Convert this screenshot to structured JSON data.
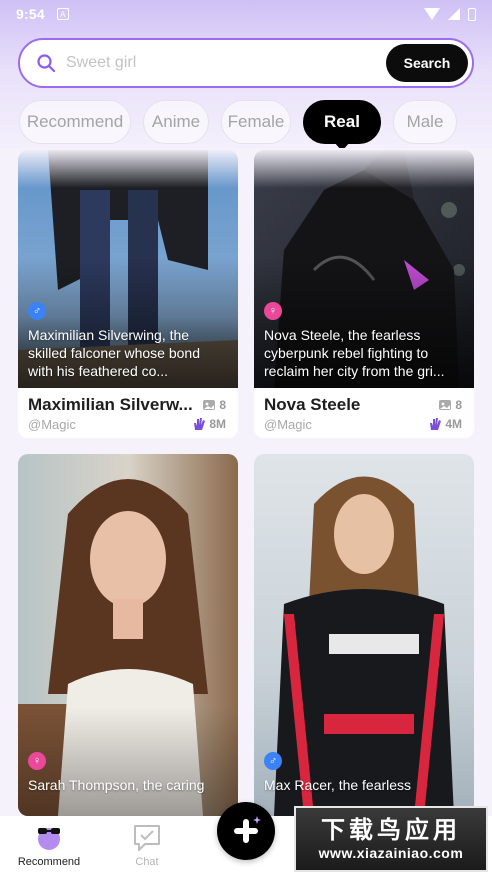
{
  "status_bar": {
    "time": "9:54",
    "notification_glyph": "A"
  },
  "search": {
    "placeholder": "Sweet girl",
    "button_label": "Search"
  },
  "tabs": [
    {
      "label": "Recommend",
      "active": false
    },
    {
      "label": "Anime",
      "active": false
    },
    {
      "label": "Female",
      "active": false
    },
    {
      "label": "Real",
      "active": true
    },
    {
      "label": "Male",
      "active": false
    }
  ],
  "cards": [
    {
      "gender": "male",
      "gender_glyph": "♂",
      "description": "Maximilian Silverwing, the skilled falconer whose bond with his feathered co...",
      "title": "Maximilian Silverw...",
      "author": "@Magic",
      "images_count": "8",
      "likes": "8M"
    },
    {
      "gender": "female",
      "gender_glyph": "♀",
      "description": "Nova Steele, the fearless cyberpunk rebel fighting to reclaim her city from the gri...",
      "title": "Nova Steele",
      "author": "@Magic",
      "images_count": "8",
      "likes": "4M"
    },
    {
      "gender": "female",
      "gender_glyph": "♀",
      "description": "Sarah Thompson, the caring"
    },
    {
      "gender": "male",
      "gender_glyph": "♂",
      "description": "Max Racer, the fearless"
    }
  ],
  "bottom_nav": {
    "items": [
      {
        "label": "Recommend",
        "icon": "recommend-avatar-icon",
        "active": true
      },
      {
        "label": "Chat",
        "icon": "chat-icon",
        "active": false
      }
    ],
    "fab_icon": "plus-icon"
  },
  "watermark": {
    "title": "下载鸟应用",
    "url": "www.xiazainiao.com"
  },
  "colors": {
    "accent": "#9b6bf0",
    "male": "#3b82f6",
    "female": "#ec4899",
    "dark": "#000000"
  }
}
